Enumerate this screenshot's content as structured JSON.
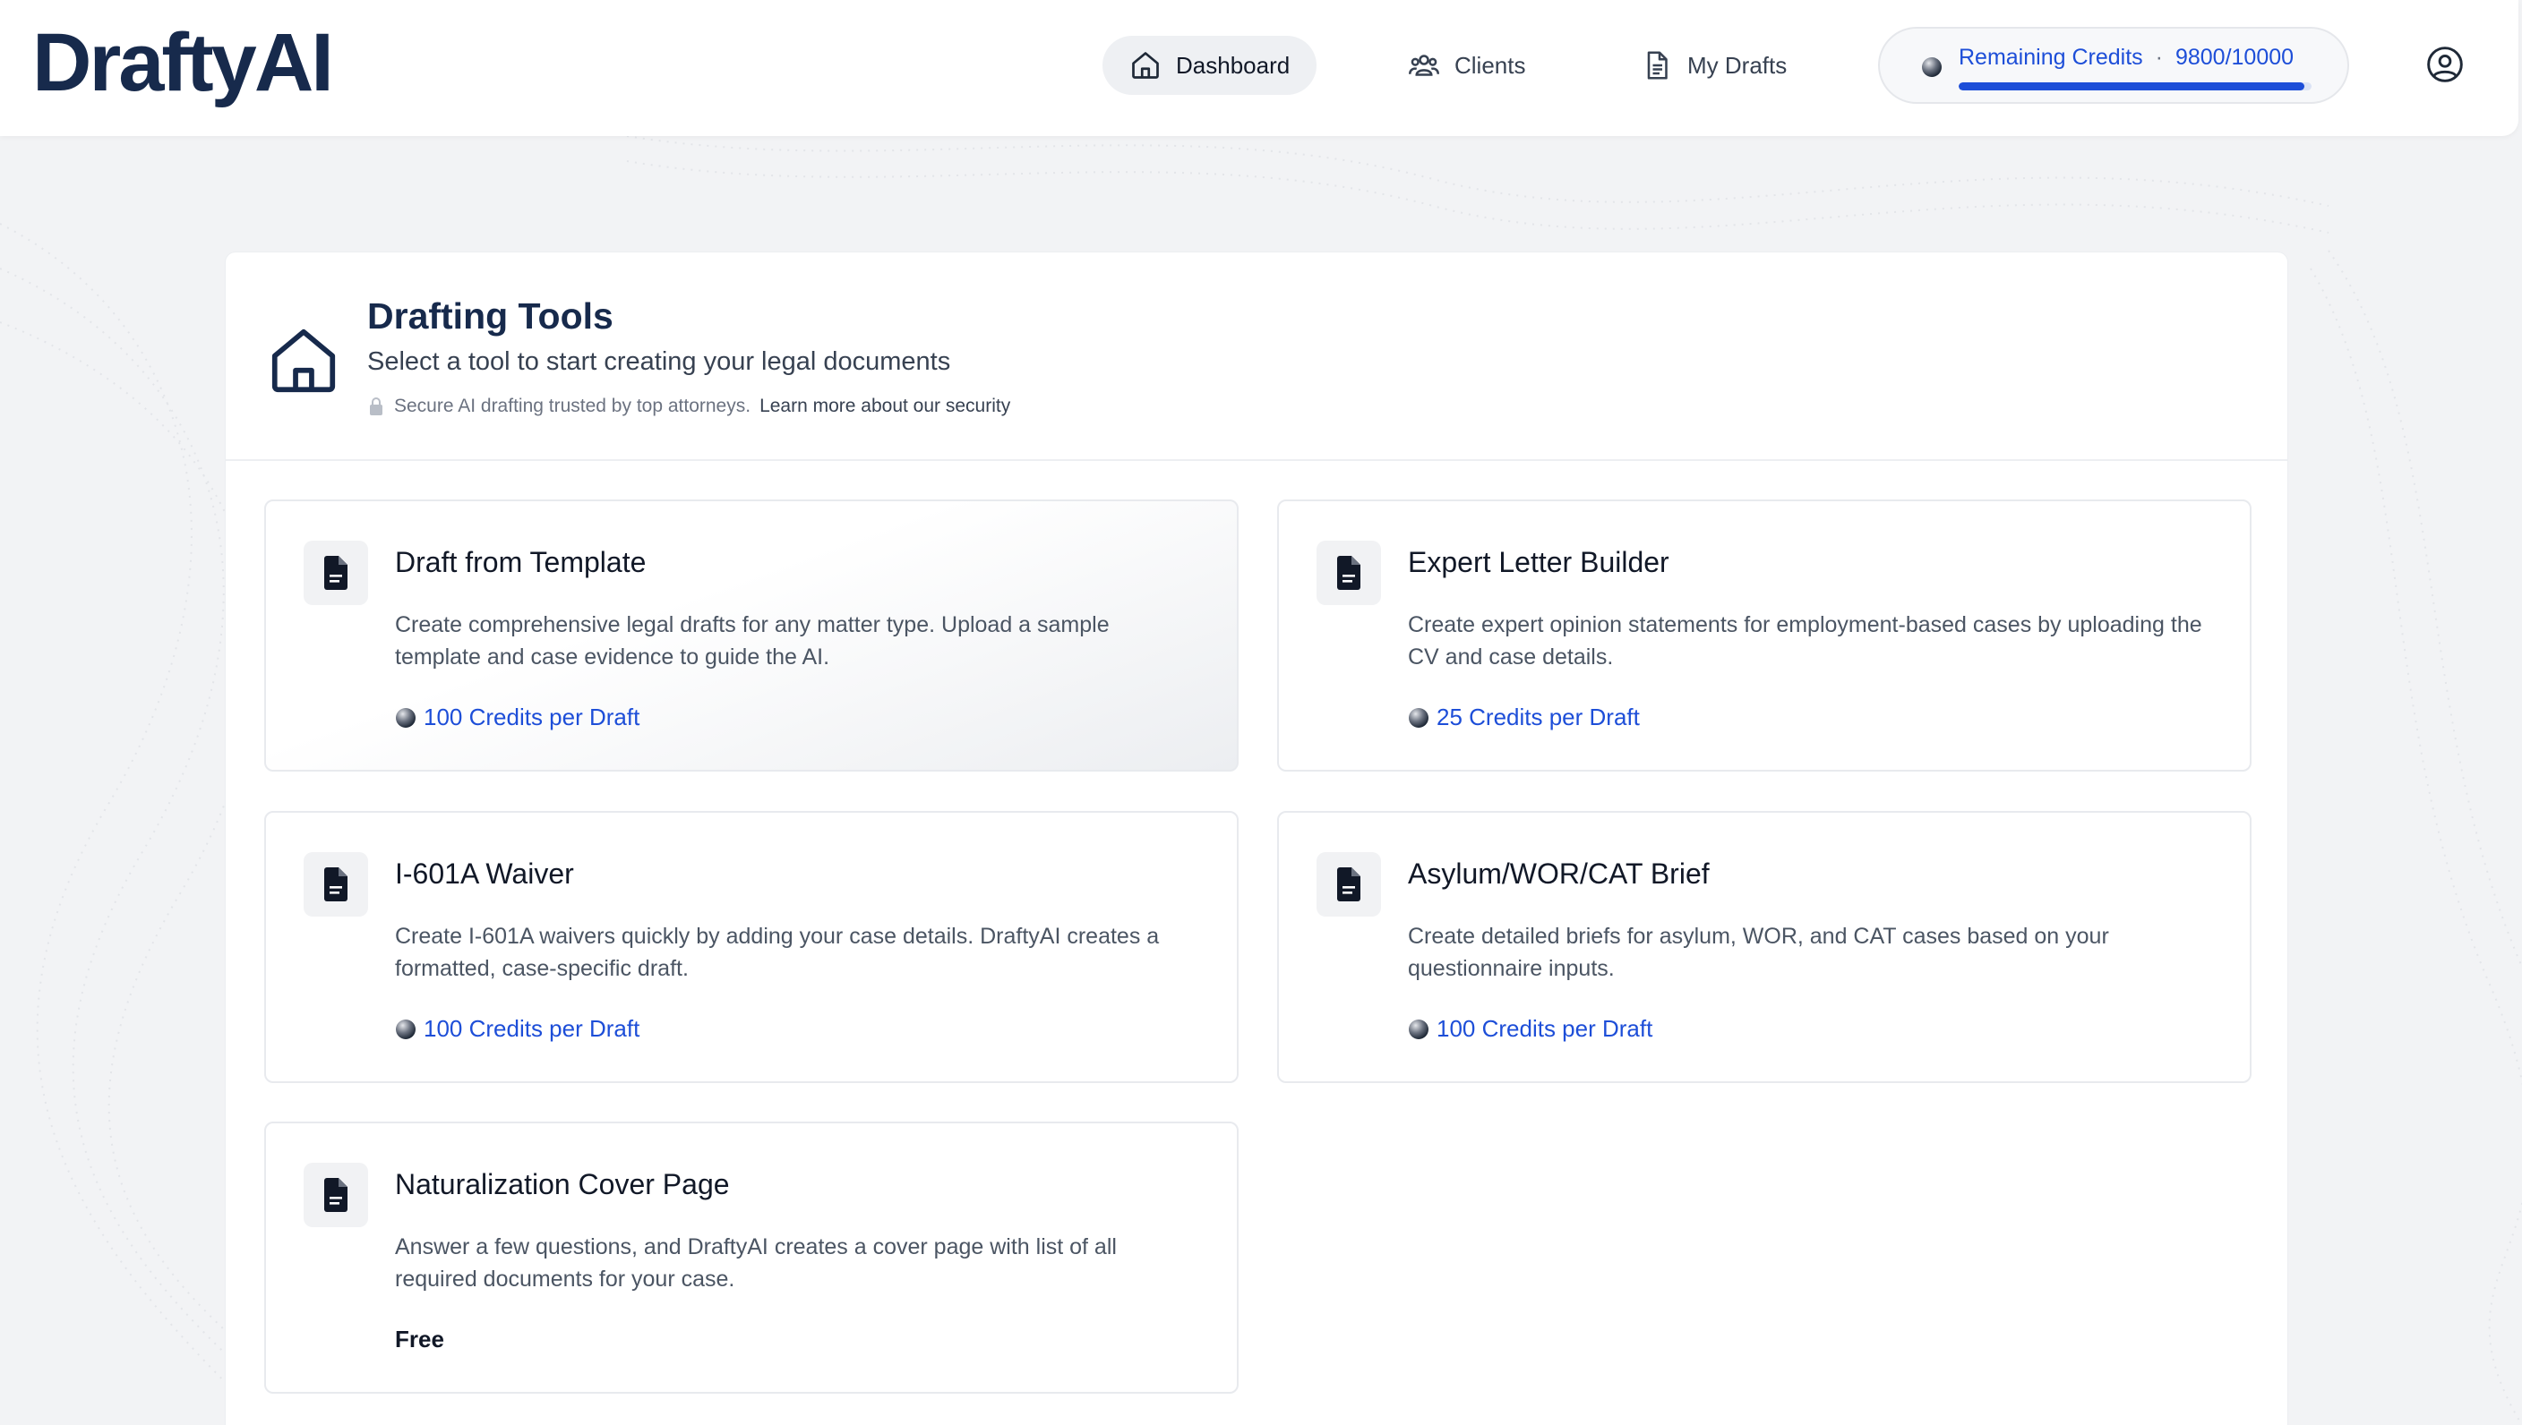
{
  "app": {
    "logo": "DraftyAI"
  },
  "nav": {
    "items": [
      {
        "label": "Dashboard",
        "icon": "home-icon",
        "active": true
      },
      {
        "label": "Clients",
        "icon": "users-icon",
        "active": false
      },
      {
        "label": "My Drafts",
        "icon": "document-icon",
        "active": false
      }
    ]
  },
  "credits": {
    "label": "Remaining Credits",
    "separator": "·",
    "value": "9800/10000",
    "fraction": 0.98,
    "icon": "coin-icon"
  },
  "profile": {
    "icon": "user-circle-icon"
  },
  "page": {
    "icon": "home-icon",
    "title": "Drafting Tools",
    "subtitle": "Select a tool to start creating your legal documents",
    "security_text": "Secure AI drafting trusted by top attorneys.",
    "security_link": "Learn more about our security",
    "security_icon": "lock-icon"
  },
  "tools": [
    {
      "title": "Draft from Template",
      "description": "Create comprehensive legal drafts for any matter type. Upload a sample template and case evidence to guide the AI.",
      "cost": "100 Credits per Draft",
      "icon": "document-icon"
    },
    {
      "title": "Expert Letter Builder",
      "description": "Create expert opinion statements for employment-based cases by uploading the CV and case details.",
      "cost": "25 Credits per Draft",
      "icon": "document-icon"
    },
    {
      "title": "I-601A Waiver",
      "description": "Create I-601A waivers quickly by adding your case details. DraftyAI creates a formatted, case-specific draft.",
      "cost": "100 Credits per Draft",
      "icon": "document-icon"
    },
    {
      "title": "Asylum/WOR/CAT Brief",
      "description": "Create detailed briefs for asylum, WOR, and CAT cases based on your questionnaire inputs.",
      "cost": "100 Credits per Draft",
      "icon": "document-icon"
    },
    {
      "title": "Naturalization Cover Page",
      "description": "Answer a few questions, and DraftyAI creates a cover page with list of all required documents for your case.",
      "cost": "Free",
      "icon": "document-icon"
    }
  ],
  "colors": {
    "brand": "#172a4c",
    "accent": "#1d4ed8",
    "background": "#f2f3f5"
  }
}
